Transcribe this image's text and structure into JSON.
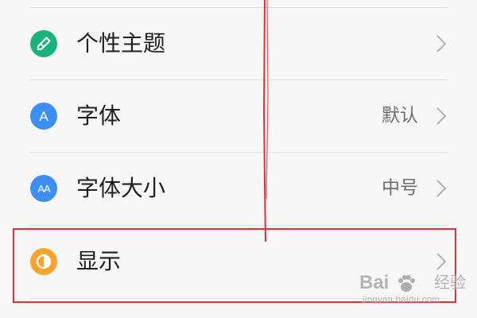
{
  "settings": {
    "items": [
      {
        "label": "个性主题",
        "value": "",
        "icon": "theme-brush-icon",
        "color": "#19b37b"
      },
      {
        "label": "字体",
        "value": "默认",
        "icon": "font-icon",
        "color": "#3d8ff5"
      },
      {
        "label": "字体大小",
        "value": "中号",
        "icon": "font-size-icon",
        "color": "#3d8ff5"
      },
      {
        "label": "显示",
        "value": "",
        "icon": "display-icon",
        "color": "#f7a530"
      }
    ]
  },
  "icons": {
    "font_letter": "A",
    "font_size_letters": "AA"
  },
  "annotation": {
    "color": "#e0303a"
  },
  "watermark": {
    "logo_text": "Bai",
    "logo_suffix": "经验",
    "url": "jingyan.baidu.com"
  },
  "colors": {
    "background": "#f7f7f7",
    "divider": "#e1e1e1",
    "label": "#1f1f1f",
    "value": "#6e6e6e",
    "chevron": "#b3b3b3"
  }
}
